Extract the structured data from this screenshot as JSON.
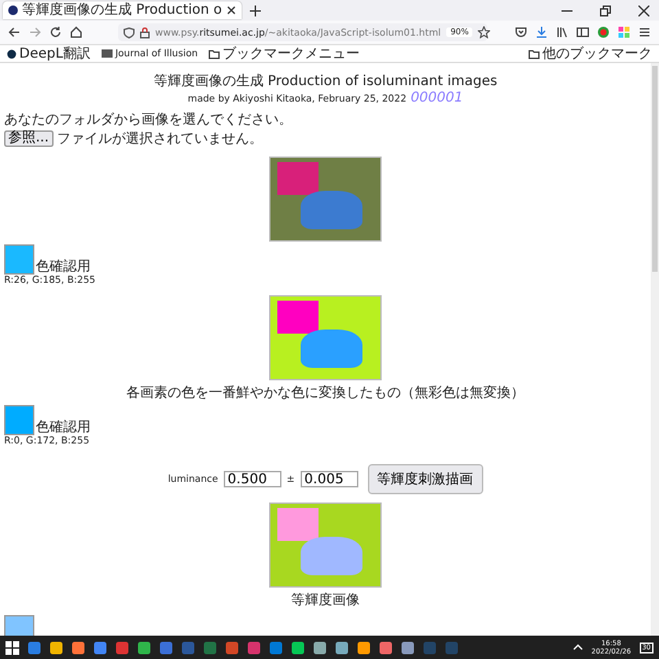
{
  "browser": {
    "tab_title": "等輝度画像の生成 Production o",
    "url": "www.psy.**ritsumei.ac.jp**/~akitaoka/JavaScript-isolum01.html",
    "zoom": "90%",
    "bookmarks": [
      {
        "label": "DeepL翻訳",
        "kind": "site"
      },
      {
        "label": "Journal of Illusion",
        "kind": "pdf"
      },
      {
        "label": "ブックマークメニュー",
        "kind": "folder"
      }
    ],
    "other_bookmarks": "他のブックマーク"
  },
  "page": {
    "title": "等輝度画像の生成 Production of isoluminant images",
    "byline": "made by Akiyoshi Kitaoka, February 25, 2022",
    "counter": "000001",
    "prompt": "あなたのフォルダから画像を選んでください。",
    "file_button": "参照...",
    "file_status": "ファイルが選択されていません。",
    "swatches": [
      {
        "label": "色確認用",
        "rgb": "R:26, G:185, B:255",
        "color": "#1ab9ff"
      },
      {
        "label": "色確認用",
        "rgb": "R:0, G:172, B:255",
        "color": "#00acff"
      }
    ],
    "caption_vivid": "各画素の色を一番鮮やかな色に変換したもの（無彩色は無変換）",
    "luminance_label": "luminance",
    "luminance_value": "0.500",
    "plus_minus": "±",
    "tolerance_value": "0.005",
    "draw_button": "等輝度刺激描画",
    "caption_iso": "等輝度画像",
    "last_swatch": {
      "color": "#80c4ff"
    }
  },
  "taskbar": {
    "time": "16:58",
    "date": "2022/02/26",
    "notifications": "30"
  }
}
